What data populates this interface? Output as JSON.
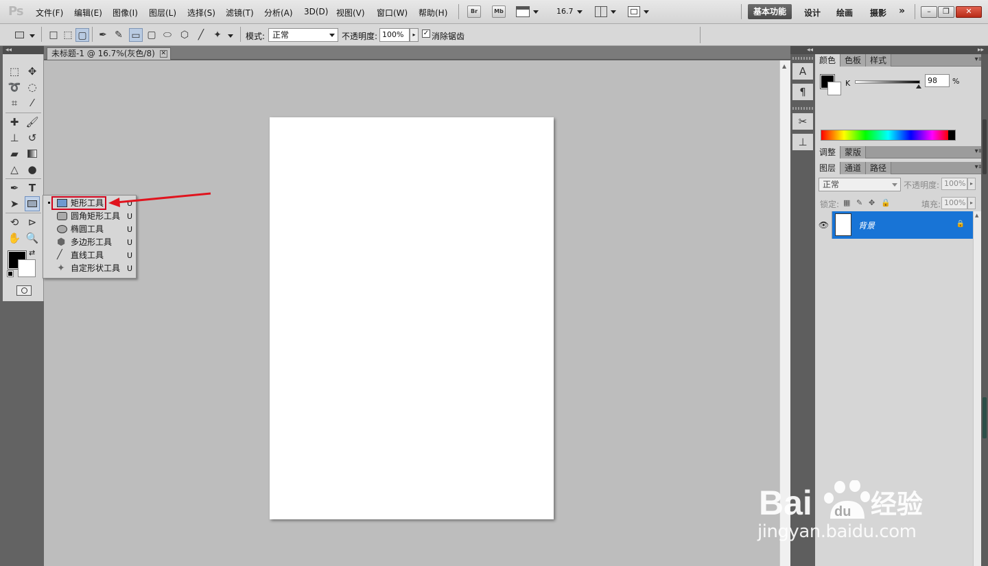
{
  "app": {
    "logo": "Ps"
  },
  "menu": [
    "文件(F)",
    "编辑(E)",
    "图像(I)",
    "图层(L)",
    "选择(S)",
    "滤镜(T)",
    "分析(A)",
    "3D(D)",
    "视图(V)",
    "窗口(W)",
    "帮助(H)"
  ],
  "menubar_buttons": {
    "bridge": "Br",
    "mini_bridge": "Mb",
    "zoom": "16.7"
  },
  "workspaces": [
    "基本功能",
    "设计",
    "绘画",
    "摄影"
  ],
  "workspace_more": "»",
  "options": {
    "mode_label": "模式:",
    "mode_value": "正常",
    "opacity_label": "不透明度:",
    "opacity_value": "100%",
    "antialias_label": "消除锯齿",
    "antialias_checked": true
  },
  "document": {
    "tab_title": "未标题-1 @ 16.7%(灰色/8)",
    "tab_close": "✕"
  },
  "flyout": [
    {
      "label": "矩形工具",
      "key": "U",
      "icon": "rectangle-icon",
      "selected": true
    },
    {
      "label": "圆角矩形工具",
      "key": "U",
      "icon": "rounded-rectangle-icon"
    },
    {
      "label": "椭圆工具",
      "key": "U",
      "icon": "ellipse-icon"
    },
    {
      "label": "多边形工具",
      "key": "U",
      "icon": "polygon-icon"
    },
    {
      "label": "直线工具",
      "key": "U",
      "icon": "line-icon"
    },
    {
      "label": "自定形状工具",
      "key": "U",
      "icon": "custom-shape-icon"
    }
  ],
  "tools": {
    "type_tool": "T"
  },
  "color_panel": {
    "tabs": [
      "颜色",
      "色板",
      "样式"
    ],
    "channel": "K",
    "value": "98",
    "unit": "%",
    "slider_level": 0.98
  },
  "adjust_panel": {
    "tabs": [
      "调整",
      "蒙版"
    ]
  },
  "layers_panel": {
    "tabs": [
      "图层",
      "通道",
      "路径"
    ],
    "blend_mode": "正常",
    "opacity_label": "不透明度:",
    "opacity_value": "100%",
    "lock_label": "锁定:",
    "fill_label": "填充:",
    "fill_value": "100%",
    "layer_name": "背景"
  },
  "watermark": {
    "brand": "Bai",
    "brand_cn": "经验",
    "brand_du": "du",
    "url": "jingyan.baidu.com"
  },
  "colors": {
    "accent_blue": "#1874d6",
    "highlight_red": "#d0021b",
    "canvas": "#ffffff",
    "workspace_bg": "#bdbdbd"
  }
}
